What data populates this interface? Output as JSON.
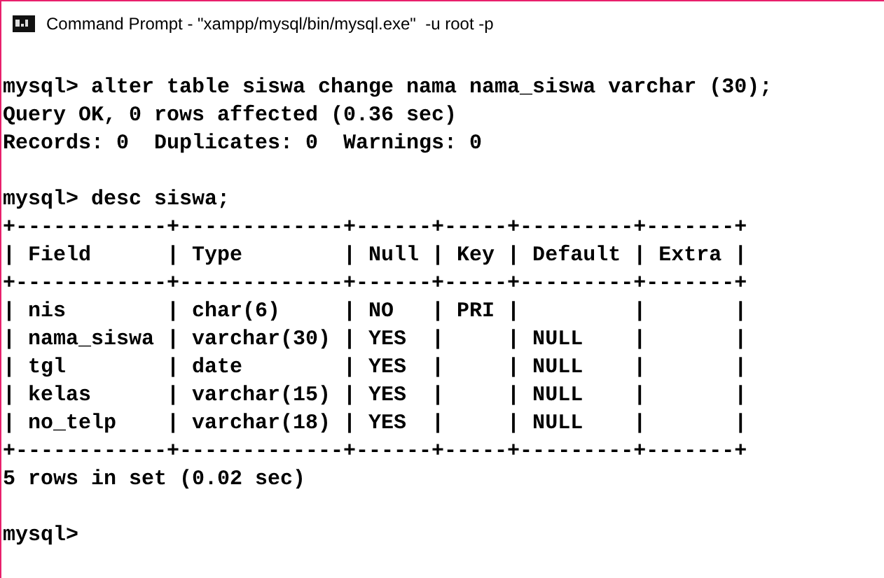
{
  "window": {
    "title": "Command Prompt - \"xampp/mysql/bin/mysql.exe\"  -u root -p"
  },
  "console": {
    "blocks": [
      [
        "mysql> alter table siswa change nama nama_siswa varchar (30);",
        "Query OK, 0 rows affected (0.36 sec)",
        "Records: 0  Duplicates: 0  Warnings: 0"
      ],
      [
        "mysql> desc siswa;",
        "+------------+-------------+------+-----+---------+-------+",
        "| Field      | Type        | Null | Key | Default | Extra |",
        "+------------+-------------+------+-----+---------+-------+",
        "| nis        | char(6)     | NO   | PRI |         |       |",
        "| nama_siswa | varchar(30) | YES  |     | NULL    |       |",
        "| tgl        | date        | YES  |     | NULL    |       |",
        "| kelas      | varchar(15) | YES  |     | NULL    |       |",
        "| no_telp    | varchar(18) | YES  |     | NULL    |       |",
        "+------------+-------------+------+-----+---------+-------+",
        "5 rows in set (0.02 sec)"
      ],
      [
        "mysql>"
      ]
    ]
  }
}
